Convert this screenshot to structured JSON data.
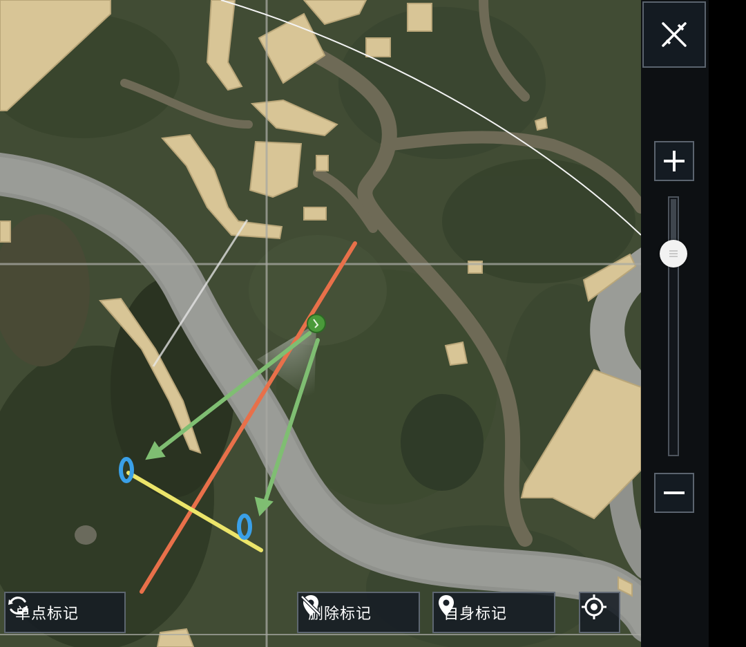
{
  "toolbar": {
    "single_mark_label": "单点标记",
    "delete_mark_label": "删除标记",
    "self_mark_label": "自身标记"
  },
  "zoom": {
    "level": 0.18
  },
  "icons": {
    "close": "close-icon",
    "zoom_in": "plus-icon",
    "zoom_out": "minus-icon",
    "single_mark": "refresh-circle-icon",
    "delete_mark": "marker-remove-icon",
    "self_mark": "location-pin-icon",
    "locate": "crosshair-icon"
  },
  "colors": {
    "annotation_red": "#e8704a",
    "annotation_green": "#7fbe72",
    "annotation_yellow": "#ece56a",
    "annotation_blue": "#3aa0e8",
    "player_marker": "#4a9a3a"
  }
}
